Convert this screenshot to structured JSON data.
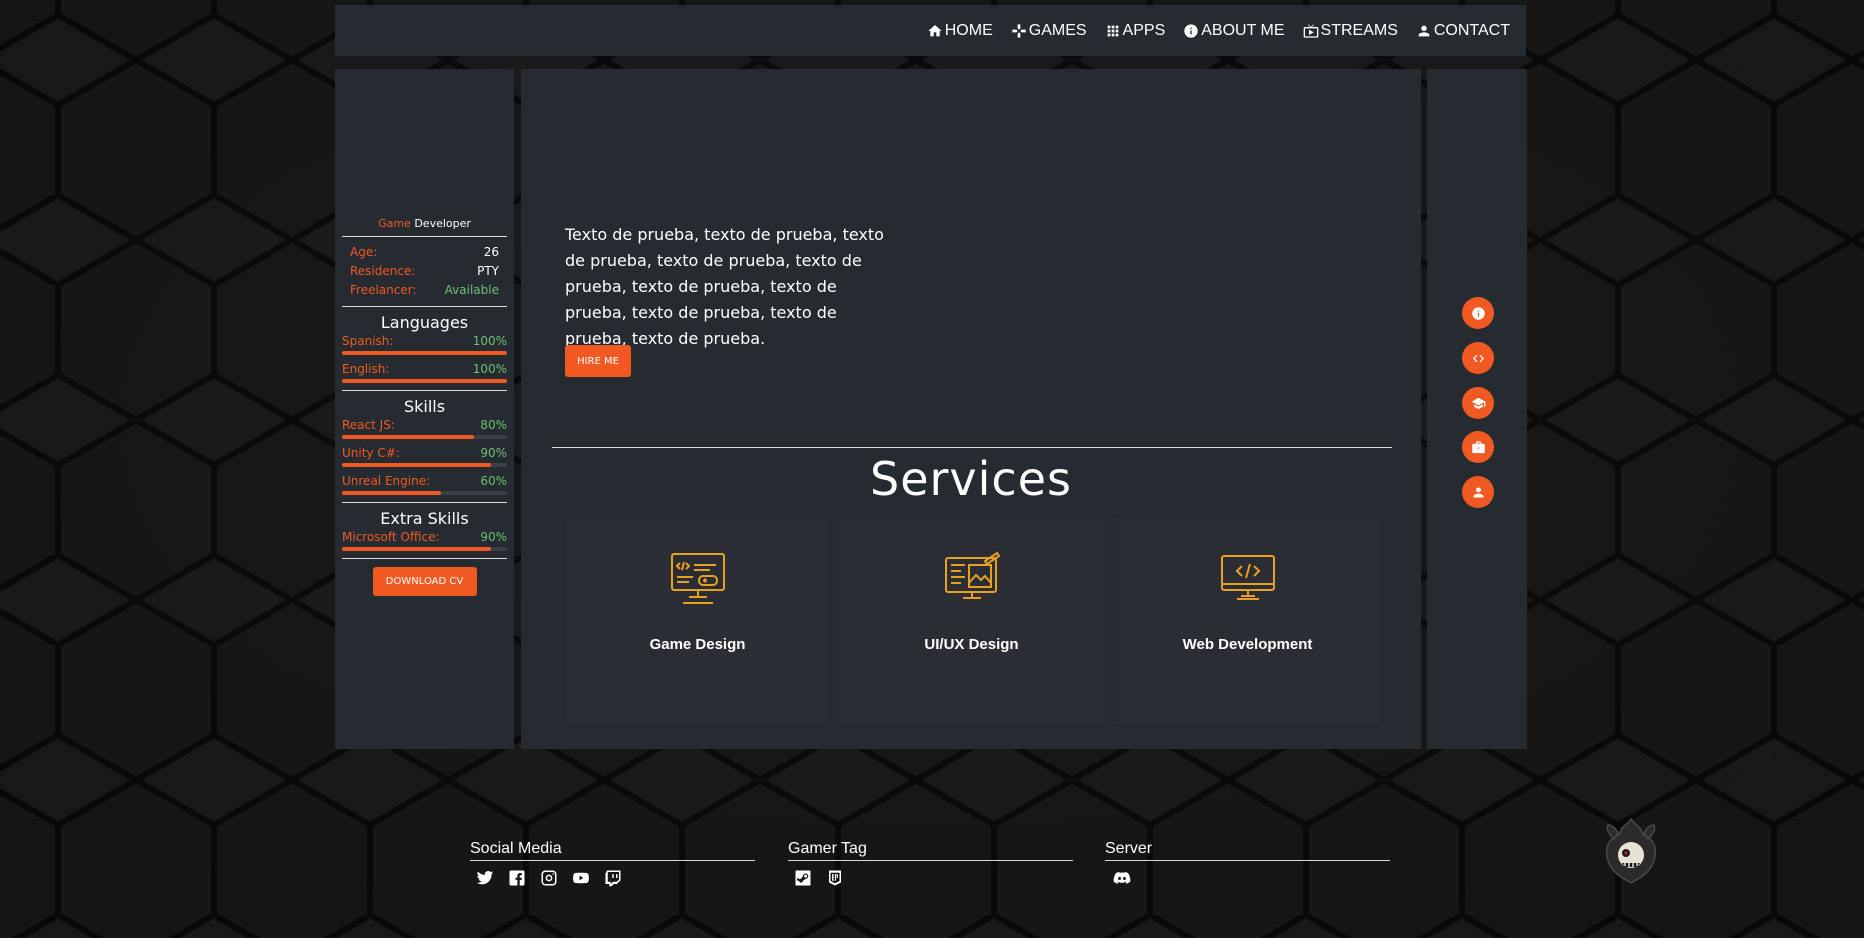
{
  "nav": {
    "items": [
      {
        "label": "HOME",
        "icon": "home-icon"
      },
      {
        "label": "GAMES",
        "icon": "gamepad-icon"
      },
      {
        "label": "APPS",
        "icon": "apps-grid-icon"
      },
      {
        "label": "ABOUT ME",
        "icon": "info-icon"
      },
      {
        "label": "STREAMS",
        "icon": "stream-icon"
      },
      {
        "label": "CONTACT",
        "icon": "user-icon"
      }
    ]
  },
  "profile": {
    "role_accent": "Game",
    "role": "Developer",
    "info": [
      {
        "key": "Age:",
        "value": "26"
      },
      {
        "key": "Residence:",
        "value": "PTY"
      },
      {
        "key": "Freelancer:",
        "value": "Available"
      }
    ],
    "languages_title": "Languages",
    "languages": [
      {
        "name": "Spanish:",
        "value": "100%",
        "level": 1.0
      },
      {
        "name": "English:",
        "value": "100%",
        "level": 1.0
      }
    ],
    "skills_title": "Skills",
    "skills": [
      {
        "name": "React JS:",
        "value": "80%",
        "level": 0.8
      },
      {
        "name": "Unity C#:",
        "value": "90%",
        "level": 0.9
      },
      {
        "name": "Unreal Engine:",
        "value": "60%",
        "level": 0.6
      }
    ],
    "extra_title": "Extra Skills",
    "extra": [
      {
        "name": "Microsoft Office:",
        "value": "90%",
        "level": 0.9
      }
    ],
    "download_label": "DOWNLOAD CV"
  },
  "main": {
    "intro": "Texto de prueba, texto de prueba, texto de prueba, texto de prueba, texto de prueba, texto de prueba, texto de prueba, texto de prueba, texto de prueba, texto de prueba.",
    "hire_label": "HIRE ME",
    "services_title": "Services",
    "services": [
      {
        "label": "Game Design",
        "icon": "game-design-icon"
      },
      {
        "label": "UI/UX Design",
        "icon": "ui-ux-design-icon"
      },
      {
        "label": "Web Development",
        "icon": "web-development-icon"
      }
    ]
  },
  "side_nav": [
    "info-icon",
    "code-icon",
    "graduation-cap-icon",
    "briefcase-icon",
    "user-icon"
  ],
  "footer": {
    "social_title": "Social Media",
    "social": [
      "twitter-icon",
      "facebook-icon",
      "instagram-icon",
      "youtube-icon",
      "twitch-icon"
    ],
    "gamer_title": "Gamer Tag",
    "gamer": [
      "steam-icon",
      "epic-games-icon"
    ],
    "server_title": "Server",
    "server": [
      "discord-icon"
    ]
  },
  "colors": {
    "accent": "#f05a22",
    "panel": "#262a31",
    "green": "#6fbf73",
    "icon_gold": "#e8a020"
  }
}
